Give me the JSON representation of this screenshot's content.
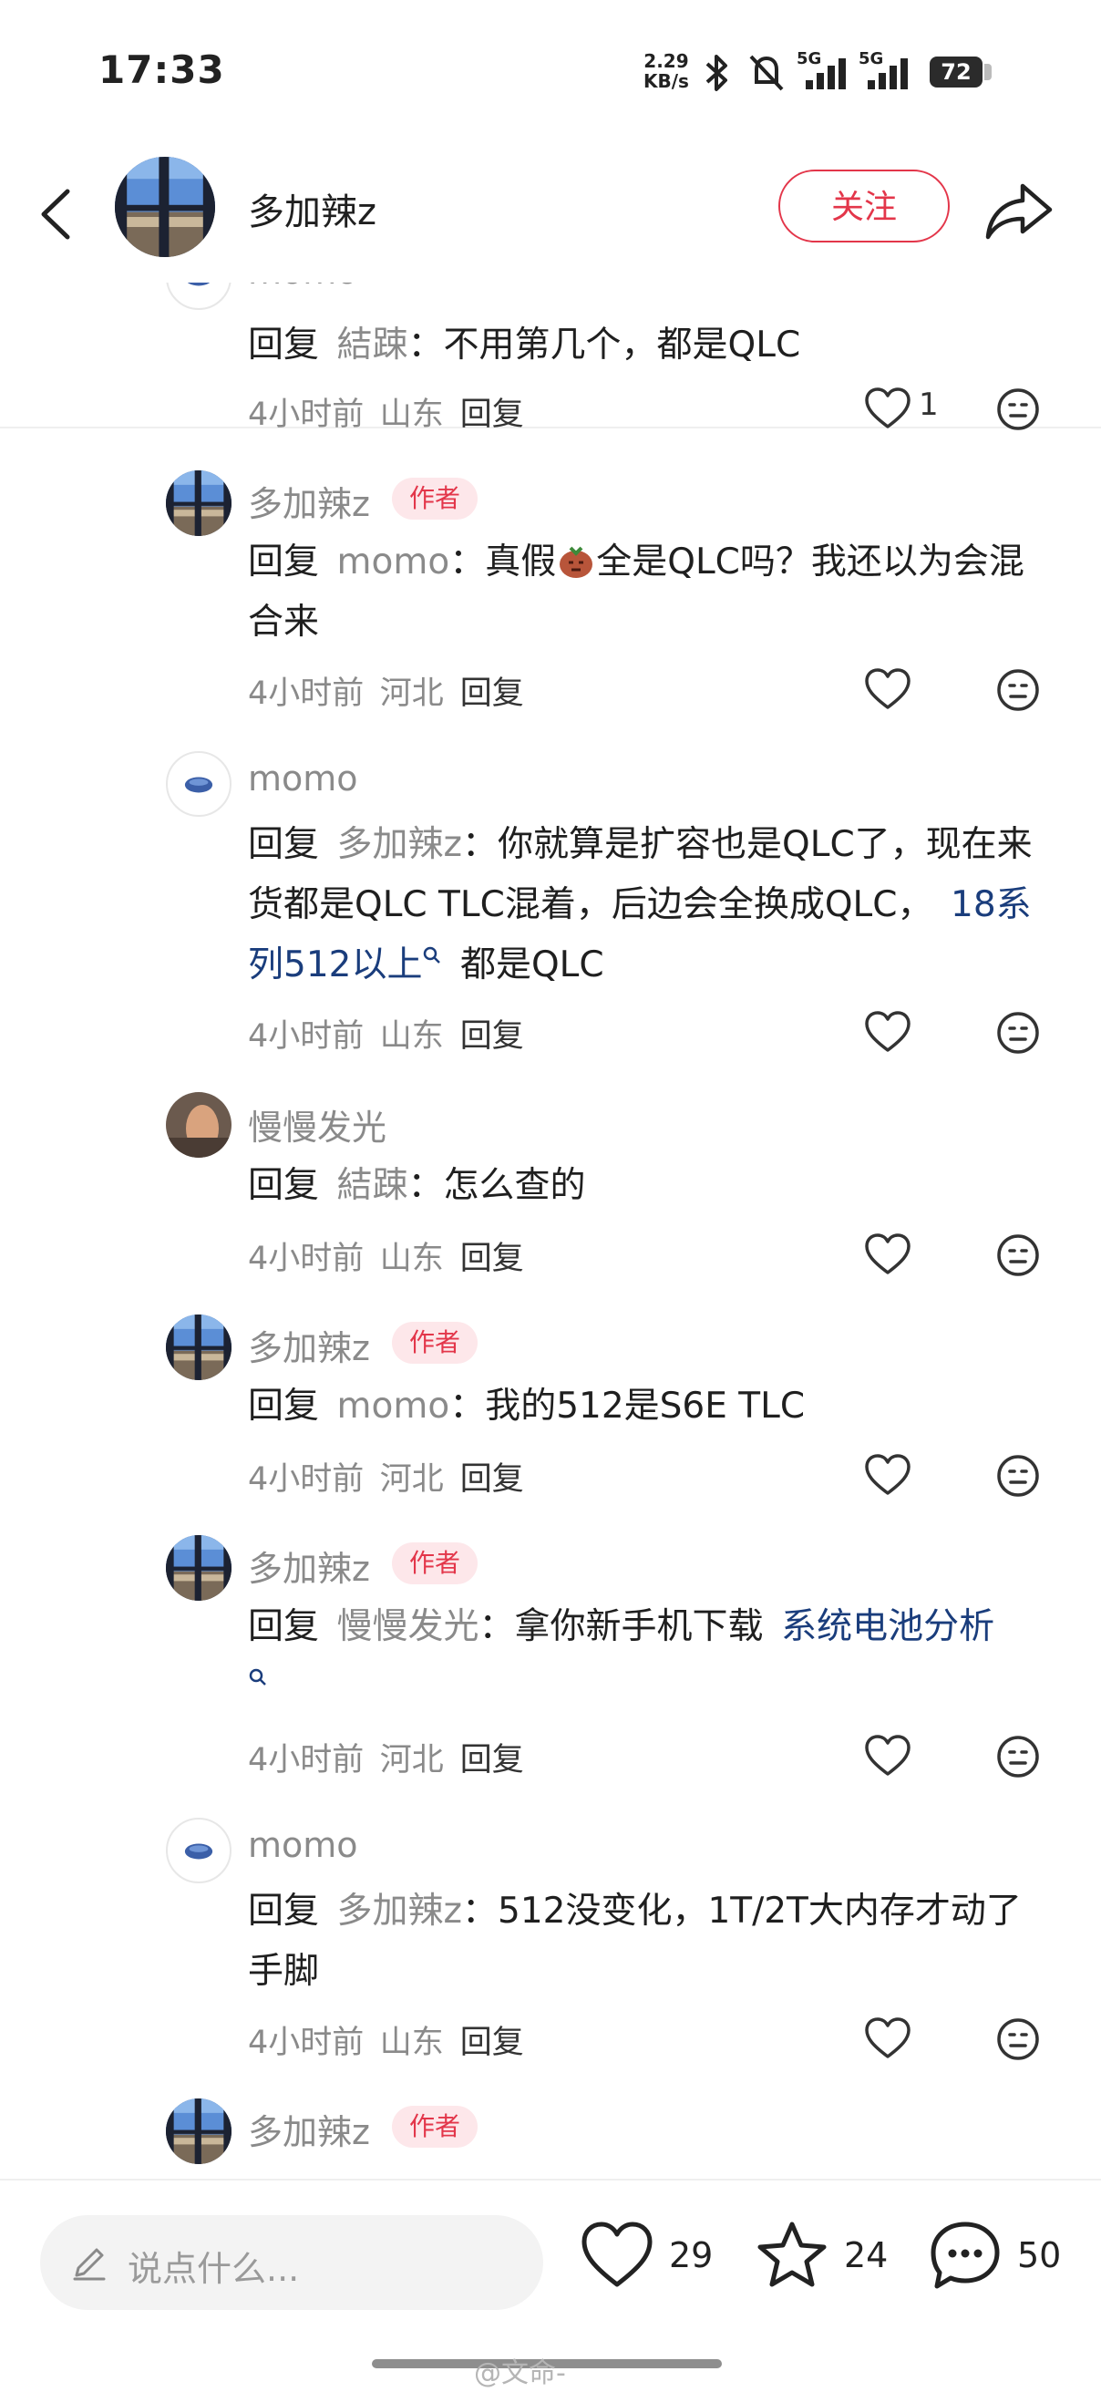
{
  "status_bar": {
    "time": "17:33",
    "net_speed_value": "2.29",
    "net_speed_unit": "KB/s",
    "signal1_label": "5G",
    "signal2_label": "5G",
    "battery": "72"
  },
  "header": {
    "username": "多加辣z",
    "follow_label": "关注"
  },
  "comments": [
    {
      "username": "momo",
      "reply_prefix": "回复",
      "reply_target": "結踈",
      "colon": "：",
      "text": "不用第几个，都是QLC",
      "time": "4小时前",
      "location": "山东",
      "reply_label": "回复",
      "likes": "1"
    },
    {
      "username": "多加辣z",
      "author_tag": "作者",
      "reply_prefix": "回复",
      "reply_target": "momo",
      "colon": "：",
      "text_before": "真假",
      "text_after": "全是QLC吗？我还以为会混合来",
      "time": "4小时前",
      "location": "河北",
      "reply_label": "回复"
    },
    {
      "username": "momo",
      "reply_prefix": "回复",
      "reply_target": "多加辣z",
      "colon": "：",
      "text": "你就算是扩容也是QLC了，现在来货都是QLC TLC混着，后边会全换成QLC，",
      "link": "18系列512以上",
      "text_after": "都是QLC",
      "time": "4小时前",
      "location": "山东",
      "reply_label": "回复"
    },
    {
      "username": "慢慢发光",
      "reply_prefix": "回复",
      "reply_target": "結踈",
      "colon": "：",
      "text": "怎么查的",
      "time": "4小时前",
      "location": "山东",
      "reply_label": "回复"
    },
    {
      "username": "多加辣z",
      "author_tag": "作者",
      "reply_prefix": "回复",
      "reply_target": "momo",
      "colon": "：",
      "text": "我的512是S6E TLC",
      "time": "4小时前",
      "location": "河北",
      "reply_label": "回复"
    },
    {
      "username": "多加辣z",
      "author_tag": "作者",
      "reply_prefix": "回复",
      "reply_target": "慢慢发光",
      "colon": "：",
      "text": "拿你新手机下载",
      "link": "系统电池分析",
      "time": "4小时前",
      "location": "河北",
      "reply_label": "回复"
    },
    {
      "username": "momo",
      "reply_prefix": "回复",
      "reply_target": "多加辣z",
      "colon": "：",
      "text": "512没变化，1T/2T大内存才动了手脚",
      "time": "4小时前",
      "location": "山东",
      "reply_label": "回复"
    },
    {
      "username": "多加辣z",
      "author_tag": "作者"
    }
  ],
  "bottom_bar": {
    "input_placeholder": "说点什么...",
    "likes": "29",
    "favorites": "24",
    "comments": "50"
  },
  "watermark": "@文命-",
  "colors": {
    "accent": "#e3364a",
    "link": "#1a3d7c",
    "secondary_text": "#8a8a8a"
  }
}
